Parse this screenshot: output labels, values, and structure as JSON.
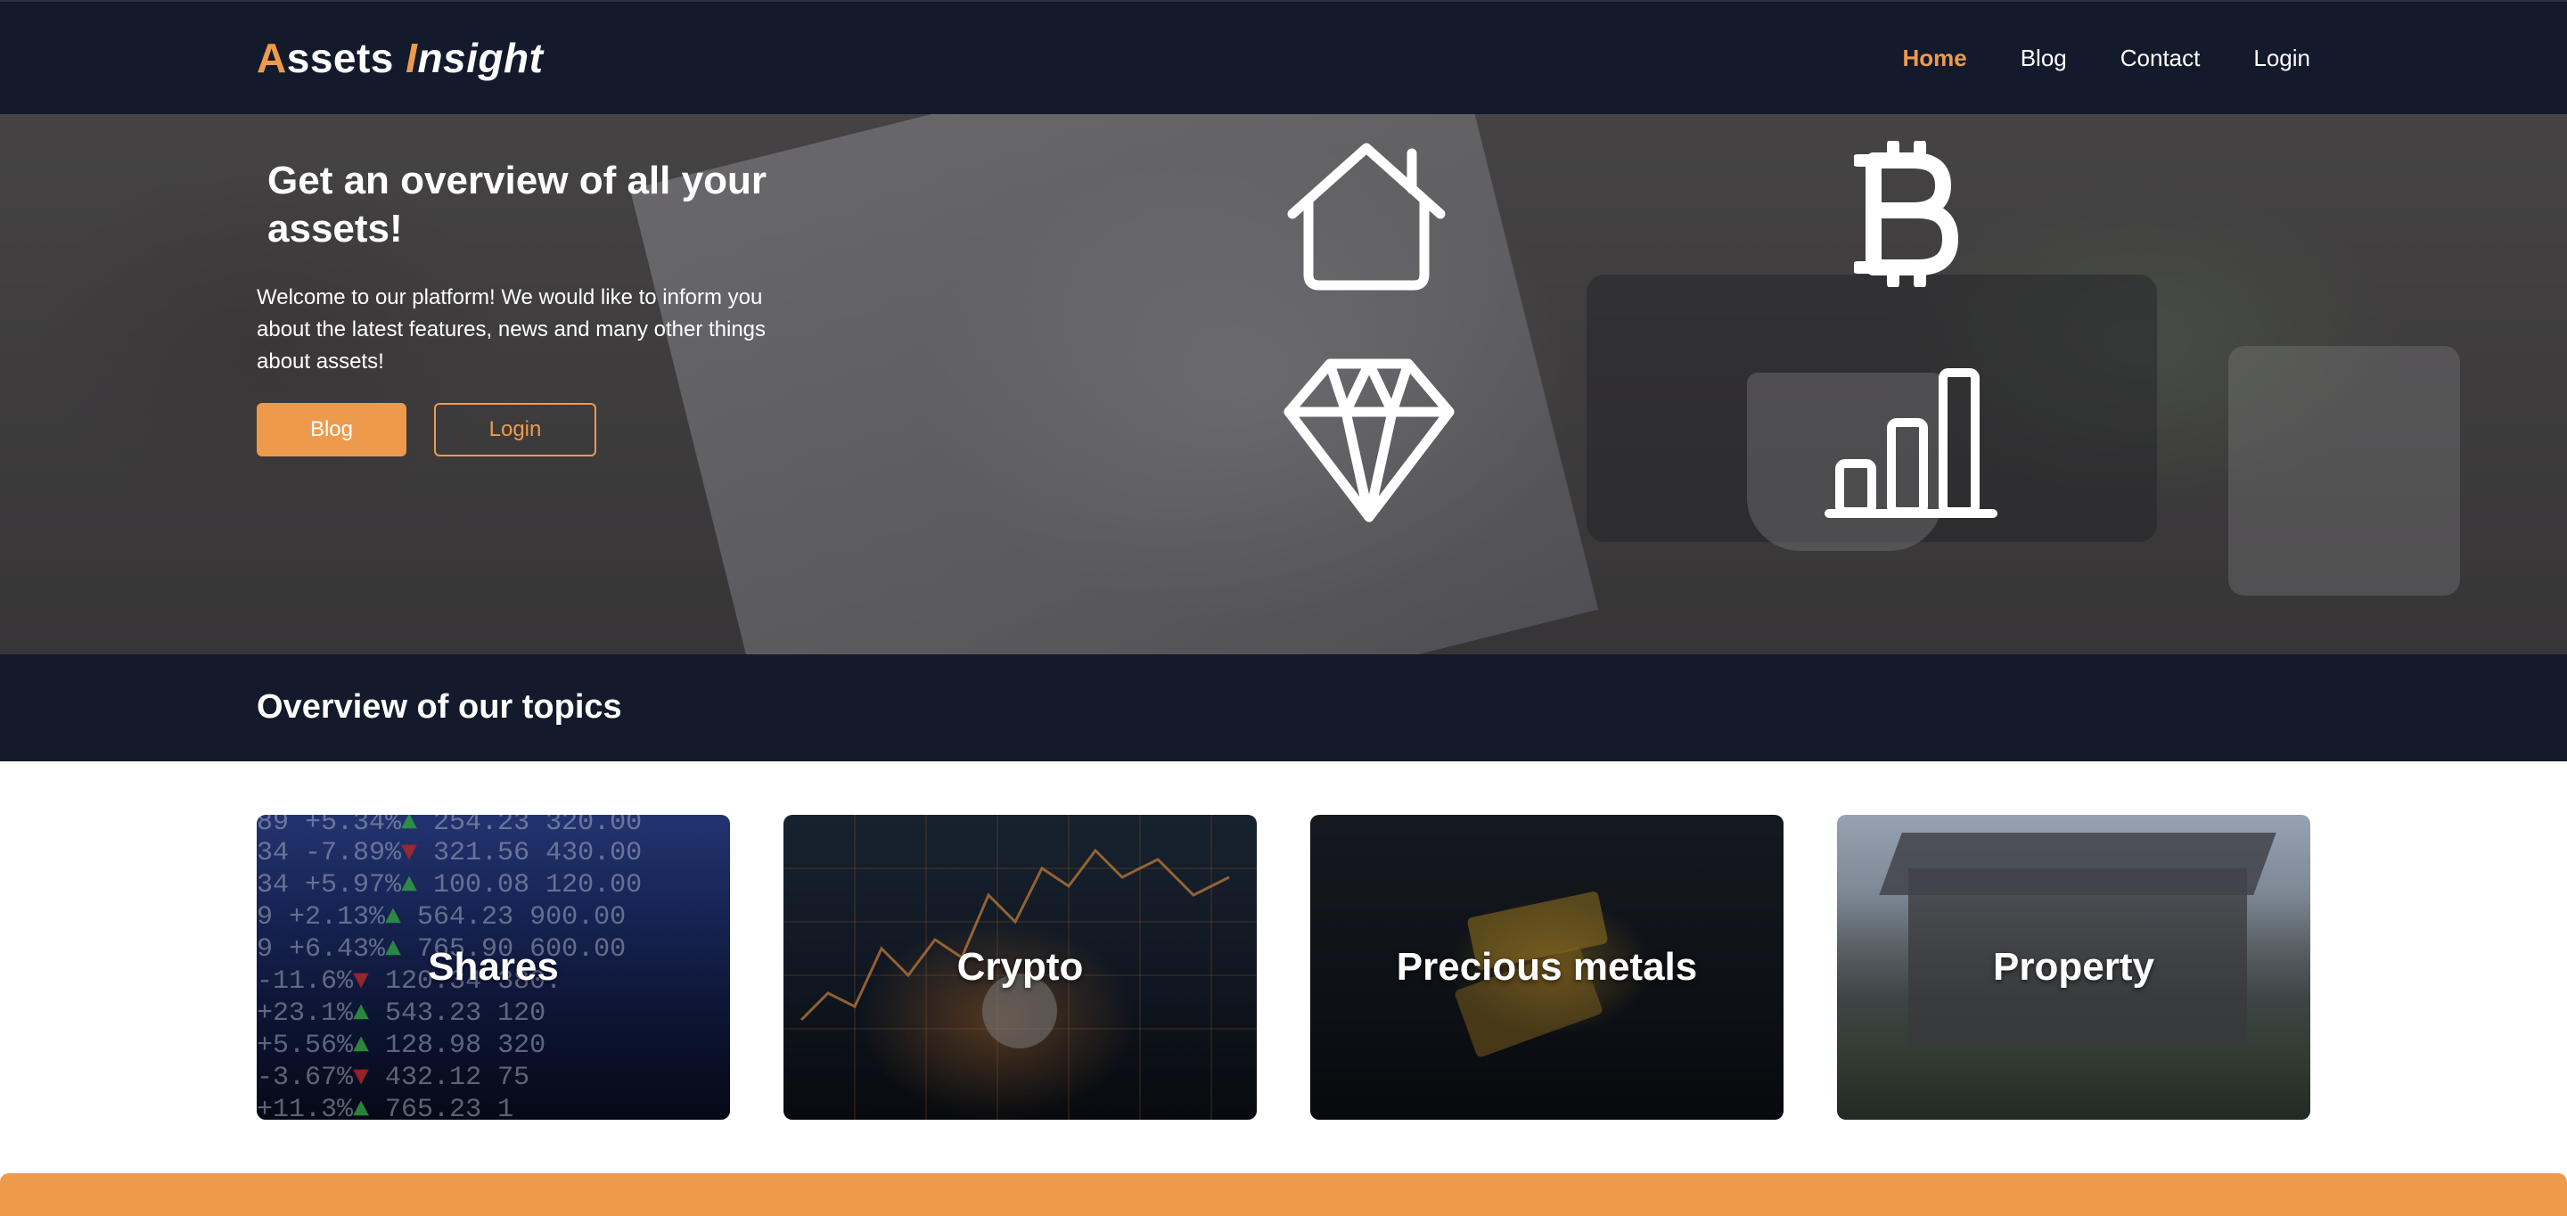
{
  "brand": {
    "first_letter": "A",
    "first_rest": "ssets ",
    "second_letter": "I",
    "second_rest": "nsight"
  },
  "nav": {
    "items": [
      {
        "label": "Home",
        "active": true
      },
      {
        "label": "Blog",
        "active": false
      },
      {
        "label": "Contact",
        "active": false
      },
      {
        "label": "Login",
        "active": false
      }
    ]
  },
  "hero": {
    "title": "Get an overview of all your assets!",
    "text": "Welcome to our platform! We would like to inform you about the latest features, news and many other things about assets!",
    "blog_button": "Blog",
    "login_button": "Login",
    "icons": [
      "house-icon",
      "bitcoin-icon",
      "diamond-icon",
      "bar-chart-icon"
    ]
  },
  "topics": {
    "title": "Overview of our topics",
    "cards": [
      {
        "label": "Shares"
      },
      {
        "label": "Crypto"
      },
      {
        "label": "Precious metals"
      },
      {
        "label": "Property"
      }
    ]
  },
  "colors": {
    "accent": "#ee9a4d",
    "navy": "#131a2b"
  }
}
